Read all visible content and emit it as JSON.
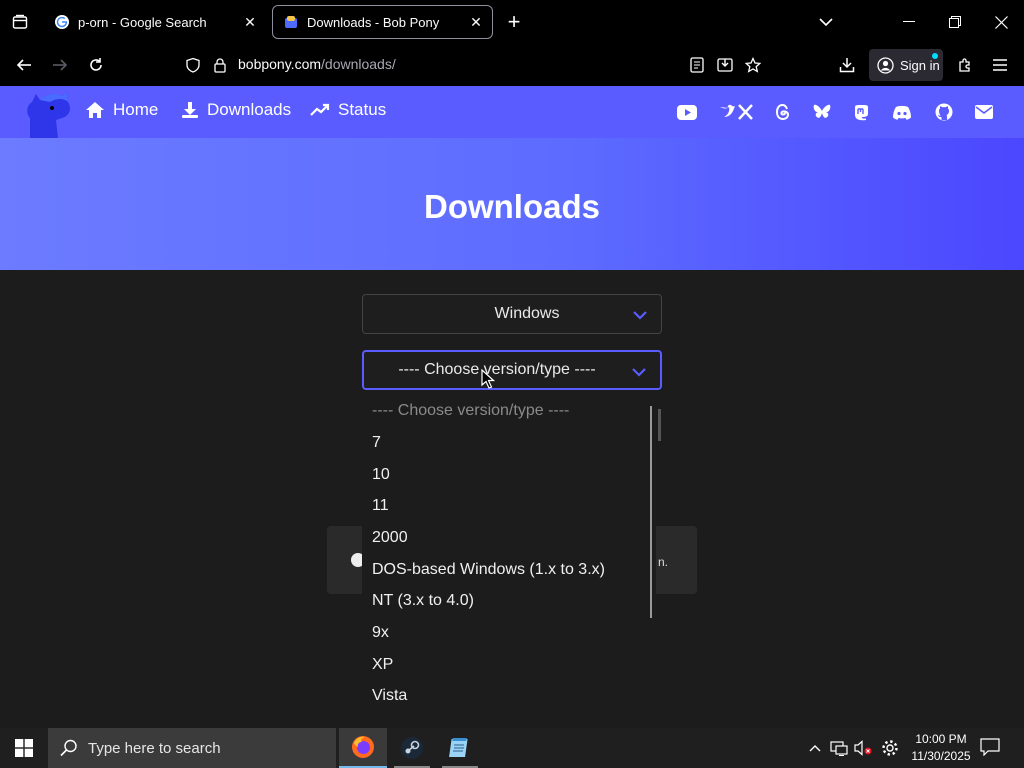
{
  "browser": {
    "tabs": [
      {
        "title": "p-orn - Google Search",
        "favicon": "google-g-icon"
      },
      {
        "title": "Downloads - Bob Pony",
        "favicon": "bobpony-icon",
        "active": true
      }
    ],
    "url_domain": "bobpony.com",
    "url_path": "/downloads/",
    "signin_label": "Sign in"
  },
  "site": {
    "nav": [
      {
        "label": "Home",
        "icon": "home-icon"
      },
      {
        "label": "Downloads",
        "icon": "download-icon"
      },
      {
        "label": "Status",
        "icon": "trend-icon"
      }
    ],
    "social": [
      "youtube-icon",
      "x-icon",
      "threads-icon",
      "bluesky-icon",
      "mastodon-icon",
      "discord-icon",
      "github-icon",
      "email-icon"
    ],
    "accent": "#5a5cff",
    "page_title": "Downloads"
  },
  "form": {
    "os_select": "Windows",
    "version_select": "---- Choose version/type ----",
    "behind_text": "n."
  },
  "dropdown": {
    "options": [
      "---- Choose version/type ----",
      "7",
      "10",
      "11",
      "2000",
      "DOS-based Windows (1.x to 3.x)",
      "NT (3.x to 4.0)",
      "9x",
      "XP",
      "Vista"
    ]
  },
  "taskbar": {
    "search_placeholder": "Type here to search",
    "apps": [
      "firefox-icon",
      "steam-icon",
      "notepad-icon"
    ],
    "time": "10:00 PM",
    "date": "11/30/2025"
  }
}
